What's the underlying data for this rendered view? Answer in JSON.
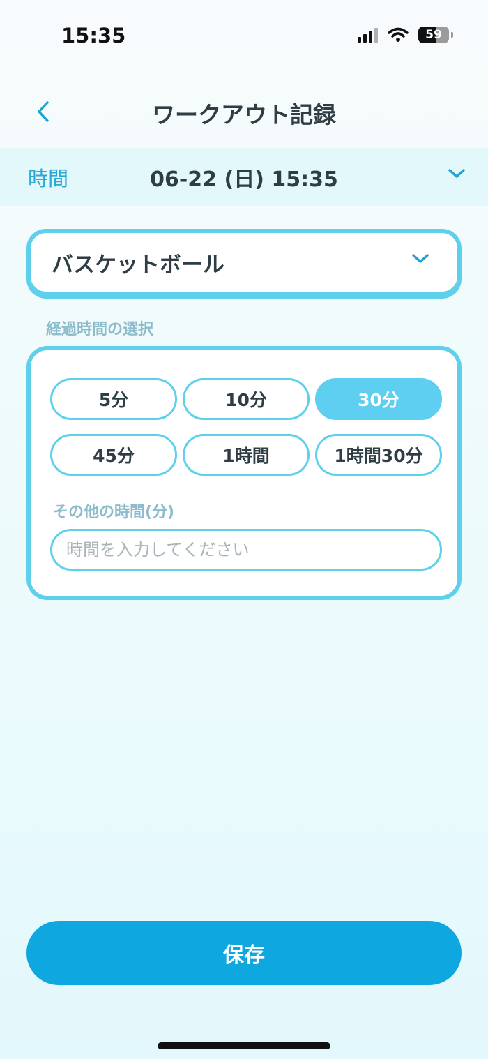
{
  "status_bar": {
    "time": "15:35",
    "battery": "59"
  },
  "nav": {
    "title": "ワークアウト記録"
  },
  "time_row": {
    "label": "時間",
    "value": "06-22 (日) 15:35"
  },
  "sport": {
    "selected": "バスケットボール"
  },
  "duration": {
    "section_label": "経過時間の選択",
    "options": [
      "5分",
      "10分",
      "30分",
      "45分",
      "1時間",
      "1時間30分"
    ],
    "selected": "30分",
    "other_label": "その他の時間(分)",
    "other_placeholder": "時間を入力してください"
  },
  "save_label": "保存",
  "colors": {
    "accent": "#5ed0ec",
    "primary_button": "#0ea7e0",
    "label": "#29a8d4"
  },
  "icons": [
    "signal-icon",
    "wifi-icon",
    "battery-icon",
    "back-chevron-icon",
    "chevron-down-icon"
  ]
}
